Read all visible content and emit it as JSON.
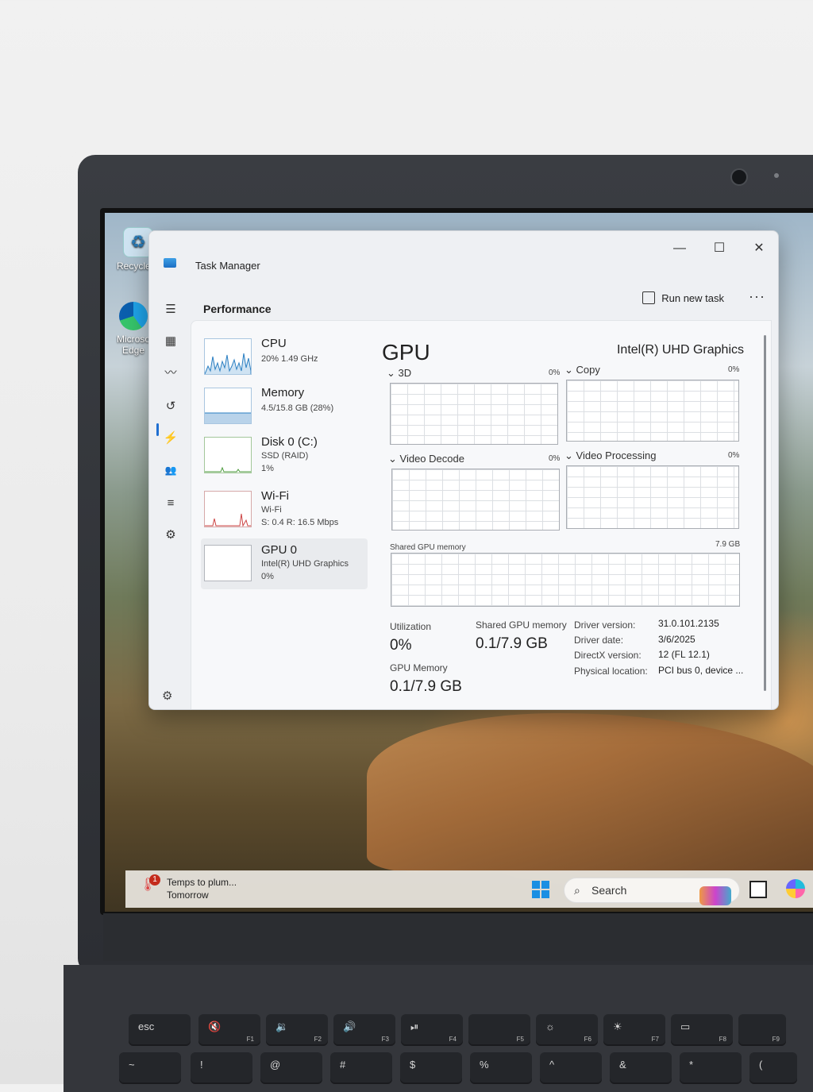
{
  "desktop": {
    "icons": [
      {
        "label": "Recycle B",
        "icon": "recycle-bin-icon"
      },
      {
        "label": "Microsoft Edge",
        "label_line1": "Microso",
        "label_line2": "Edge",
        "icon": "edge-icon"
      }
    ]
  },
  "window": {
    "title": "Task Manager",
    "minimize": "—",
    "maximize": "☐",
    "close": "✕"
  },
  "header": {
    "page_title": "Performance",
    "run_new_task": "Run new task",
    "more": "···"
  },
  "nav": {
    "items": [
      {
        "icon": "hamburger-menu-icon",
        "glyph": "☰"
      },
      {
        "icon": "processes-icon",
        "glyph": "▦"
      },
      {
        "icon": "performance-icon",
        "glyph": "〰"
      },
      {
        "icon": "app-history-icon",
        "glyph": "↺"
      },
      {
        "icon": "startup-apps-icon",
        "glyph": "⚡"
      },
      {
        "icon": "users-icon",
        "glyph": "👥"
      },
      {
        "icon": "details-icon",
        "glyph": "≡"
      },
      {
        "icon": "services-icon",
        "glyph": "⚙"
      }
    ],
    "settings_glyph": "⚙"
  },
  "devices": [
    {
      "name": "CPU",
      "sub1": "20%  1.49 GHz",
      "sub2": "",
      "sub3": ""
    },
    {
      "name": "Memory",
      "sub1": "4.5/15.8 GB (28%)",
      "sub2": "",
      "sub3": ""
    },
    {
      "name": "Disk 0 (C:)",
      "sub1": "SSD (RAID)",
      "sub2": "1%",
      "sub3": ""
    },
    {
      "name": "Wi-Fi",
      "sub1": "Wi-Fi",
      "sub2": "S: 0.4  R: 16.5 Mbps",
      "sub3": ""
    },
    {
      "name": "GPU 0",
      "sub1": "Intel(R) UHD Graphics",
      "sub2": "0%",
      "sub3": ""
    }
  ],
  "detail": {
    "title": "GPU",
    "model": "Intel(R) UHD Graphics",
    "engines": [
      {
        "label": "3D",
        "pct": "0%"
      },
      {
        "label": "Copy",
        "pct": "0%"
      },
      {
        "label": "Video Decode",
        "pct": "0%"
      },
      {
        "label": "Video Processing",
        "pct": "0%"
      }
    ],
    "shared_label": "Shared GPU memory",
    "shared_max": "7.9 GB",
    "stats": {
      "utilization_label": "Utilization",
      "utilization_value": "0%",
      "shared_mem_label": "Shared GPU memory",
      "shared_mem_value": "0.1/7.9 GB",
      "gpu_mem_label": "GPU Memory",
      "gpu_mem_value": "0.1/7.9 GB"
    },
    "info": [
      {
        "label": "Driver version:",
        "value": "31.0.101.2135"
      },
      {
        "label": "Driver date:",
        "value": "3/6/2025"
      },
      {
        "label": "DirectX version:",
        "value": "12 (FL 12.1)"
      },
      {
        "label": "Physical location:",
        "value": "PCI bus 0, device ..."
      }
    ]
  },
  "taskbar": {
    "weather_line1": "Temps to plum...",
    "weather_line2": "Tomorrow",
    "weather_badge": "1",
    "search_placeholder": "Search"
  },
  "keyboard": {
    "row1": [
      {
        "main": "esc",
        "fn": ""
      },
      {
        "main": "🔇",
        "fn": "F1"
      },
      {
        "main": "🔉",
        "fn": "F2"
      },
      {
        "main": "🔊",
        "fn": "F3"
      },
      {
        "main": "⏯",
        "fn": "F4"
      },
      {
        "main": "",
        "fn": "F5"
      },
      {
        "main": "☼",
        "fn": "F6"
      },
      {
        "main": "☀",
        "fn": "F7"
      },
      {
        "main": "▭",
        "fn": "F8"
      },
      {
        "main": "",
        "fn": "F9"
      }
    ],
    "row2": [
      {
        "main": "~"
      },
      {
        "main": "!"
      },
      {
        "main": "@"
      },
      {
        "main": "#"
      },
      {
        "main": "$"
      },
      {
        "main": "%"
      },
      {
        "main": "^"
      },
      {
        "main": "&"
      },
      {
        "main": "*"
      },
      {
        "main": "("
      }
    ]
  }
}
